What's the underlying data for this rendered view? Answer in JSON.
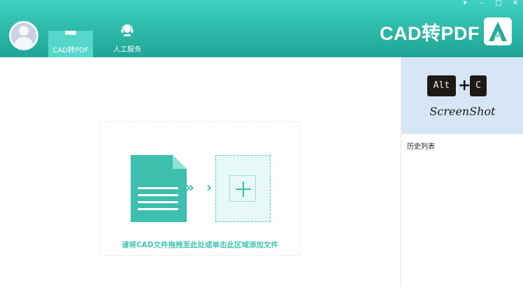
{
  "header": {
    "brand_title": "CAD转PDF",
    "tabs": [
      {
        "label": "CAD转PDF",
        "icon": "document-icon",
        "active": true
      },
      {
        "label": "人工服务",
        "icon": "headset-icon",
        "active": false
      }
    ],
    "window_controls": {
      "menu": "▾",
      "minimize": "–",
      "maximize": "□",
      "close": "✕"
    }
  },
  "main": {
    "drop_hint": "请将CAD文件拖拽至此处或单击此区域添加文件",
    "double_arrow": "»",
    "single_arrow": "›"
  },
  "side": {
    "screenshot": {
      "key1": "Alt",
      "plus": "+",
      "key2": "C",
      "label": "ScreenShot"
    },
    "history_title": "历史列表"
  },
  "colors": {
    "accent": "#2fbcab",
    "accent_light": "#45c6b5",
    "doc_icon": "#3cbfaf",
    "panel_bg": "#d7e6f4"
  }
}
